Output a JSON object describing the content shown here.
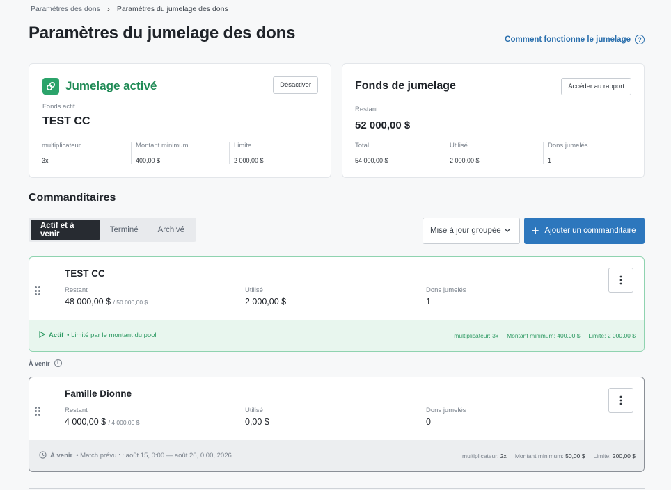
{
  "breadcrumb": {
    "parent": "Paramètres des dons",
    "current": "Paramètres du jumelage des dons"
  },
  "page": {
    "title": "Paramètres du jumelage des dons",
    "help_link": "Comment fonctionne le jumelage"
  },
  "matching_card": {
    "status": "Jumelage activé",
    "deactivate_label": "Désactiver",
    "fund_label": "Fonds actif",
    "fund_name": "TEST CC",
    "multiplier_label": "multiplicateur",
    "multiplier": "3x",
    "min_label": "Montant minimum",
    "min_value": "400,00 $",
    "limit_label": "Limite",
    "limit_value": "2 000,00 $"
  },
  "fund_card": {
    "title": "Fonds de jumelage",
    "report_label": "Accéder au rapport",
    "remaining_label": "Restant",
    "remaining_value": "52 000,00 $",
    "total_label": "Total",
    "total_value": "54 000,00 $",
    "used_label": "Utilisé",
    "used_value": "2 000,00 $",
    "matched_label": "Dons jumelés",
    "matched_value": "1"
  },
  "sponsors_section": {
    "title": "Commanditaires",
    "tabs": [
      "Actif et à venir",
      "Terminé",
      "Archivé"
    ],
    "bulk_update_label": "Mise à jour groupée",
    "add_label": "Ajouter un commanditaire",
    "upcoming_divider": "À venir"
  },
  "sponsors": [
    {
      "name": "TEST CC",
      "remaining_label": "Restant",
      "remaining": "48 000,00 $",
      "remaining_total": "/ 50 000,00 $",
      "used_label": "Utilisé",
      "used": "2 000,00 $",
      "matched_label": "Dons jumelés",
      "matched": "1",
      "status_label": "Actif",
      "status_detail": "• Limité par le montant du pool",
      "multiplier": "multiplicateur: 3x",
      "minimum": "Montant minimum: 400,00 $",
      "limit": "Limite: 2 000,00 $"
    },
    {
      "name": "Famille Dionne",
      "remaining_label": "Restant",
      "remaining": "4 000,00 $",
      "remaining_total": "/ 4 000,00 $",
      "used_label": "Utilisé",
      "used": "0,00 $",
      "matched_label": "Dons jumelés",
      "matched": "0",
      "status_label": "À venir",
      "status_detail": "• Match prévu : : août 15, 0:00 — août 26, 0:00, 2026",
      "multiplier_label": "multiplicateur:",
      "multiplier": "2x",
      "minimum_label": "Montant minimum:",
      "minimum": "50,00 $",
      "limit_label": "Limite:",
      "limit": "200,00 $"
    }
  ],
  "colors": {
    "accent": "#2d77bd",
    "success": "#2ba36a",
    "dark_tab": "#272b31"
  }
}
